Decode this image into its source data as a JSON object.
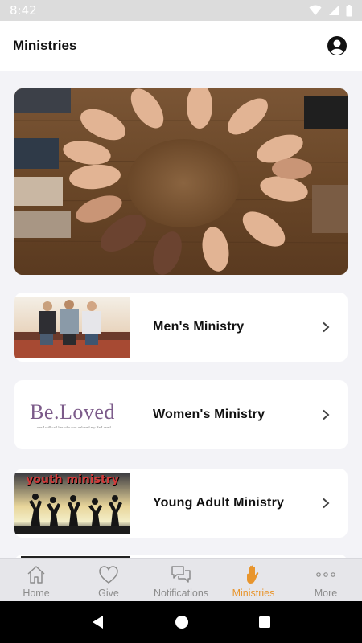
{
  "status": {
    "time": "8:42"
  },
  "header": {
    "title": "Ministries",
    "profile_icon": "account-circle-icon"
  },
  "hero": {
    "image": "circle-of-hands-photo"
  },
  "ministries": [
    {
      "label": "Men's Ministry",
      "thumb": "mens-group-photo"
    },
    {
      "label": "Women's Ministry",
      "thumb": "be-loved-logo",
      "thumb_text": "Be.Loved",
      "thumb_subtext": "...one I will call her who was unloved my Be Loved"
    },
    {
      "label": "Young Adult Ministry",
      "thumb": "youth-ministry-photo",
      "thumb_text": "youth ministry"
    }
  ],
  "tabs": [
    {
      "label": "Home",
      "icon": "home-icon"
    },
    {
      "label": "Give",
      "icon": "heart-icon"
    },
    {
      "label": "Notifications",
      "icon": "chat-bubbles-icon"
    },
    {
      "label": "Ministries",
      "icon": "hand-icon",
      "active": true
    },
    {
      "label": "More",
      "icon": "more-dots-icon"
    }
  ],
  "colors": {
    "accent": "#e8952d",
    "background": "#f3f3f7",
    "tab_inactive": "#8c8c8c"
  }
}
